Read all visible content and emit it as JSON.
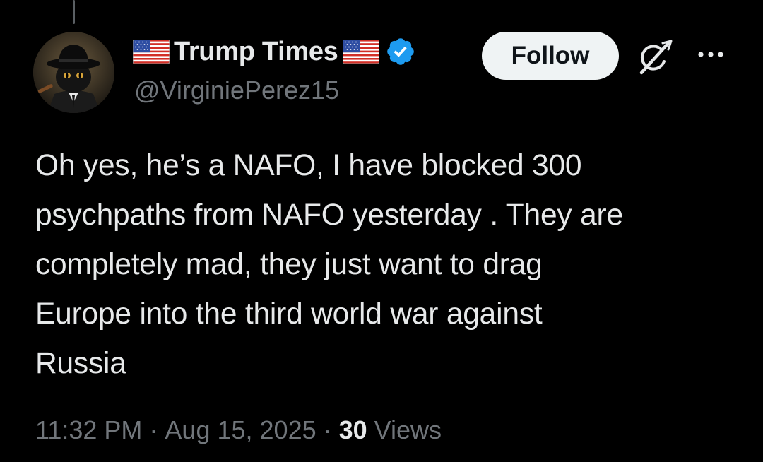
{
  "author": {
    "display_name": "Trump Times",
    "handle": "@VirginiePerez15",
    "verified": true,
    "flag_icon": "us-flag-icon",
    "verified_color": "#1d9bf0"
  },
  "actions": {
    "follow_label": "Follow",
    "grok_icon": "grok-icon",
    "more_icon": "more-icon"
  },
  "tweet": {
    "text": "Oh yes, he’s a NAFO, I have blocked 300\npsychpaths from NAFO yesterday . They are\ncompletely mad, they just want to drag\nEurope into the third world war against\nRussia"
  },
  "meta": {
    "time": "11:32 PM",
    "separator": "·",
    "date": "Aug 15, 2025",
    "views_count": "30",
    "views_label": "Views"
  },
  "colors": {
    "background": "#000000",
    "primary_text": "#e7e9ea",
    "secondary_text": "#71767b",
    "follow_bg": "#eff3f4"
  }
}
